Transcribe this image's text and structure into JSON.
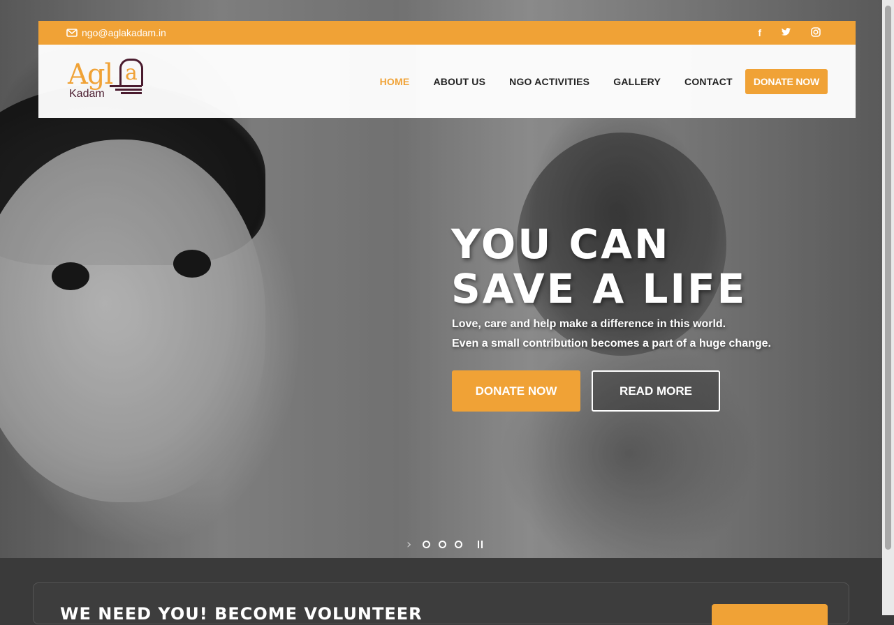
{
  "topbar": {
    "email": "ngo@aglakadam.in",
    "socials": [
      {
        "icon": "facebook-icon",
        "glyph": "f"
      },
      {
        "icon": "twitter-icon",
        "glyph": "🐦"
      },
      {
        "icon": "instagram-icon",
        "glyph": "◎"
      }
    ]
  },
  "logo": {
    "text_main": "Agl",
    "text_a": "a",
    "text_sub": "Kadam"
  },
  "nav": {
    "items": [
      "HOME",
      "ABOUT US",
      "NGO ACTIVITIES",
      "GALLERY",
      "CONTACT"
    ],
    "active_index": 0,
    "donate": "DONATE NOW"
  },
  "hero": {
    "headline_line1": "YOU CAN",
    "headline_line2": "SAVE A LIFE",
    "sub_line1": "Love, care and help make a difference in this world.",
    "sub_line2": "Even a small contribution becomes a part of a huge change.",
    "btn_donate": "DONATE NOW",
    "btn_read": "READ MORE",
    "slider": {
      "arrow": "›",
      "slides": 3
    }
  },
  "volunteer": {
    "title": "WE NEED YOU! BECOME VOLUNTEER"
  },
  "colors": {
    "accent": "#f0a236",
    "brand_dark": "#4a1b2e",
    "band": "#3a3a3a"
  }
}
